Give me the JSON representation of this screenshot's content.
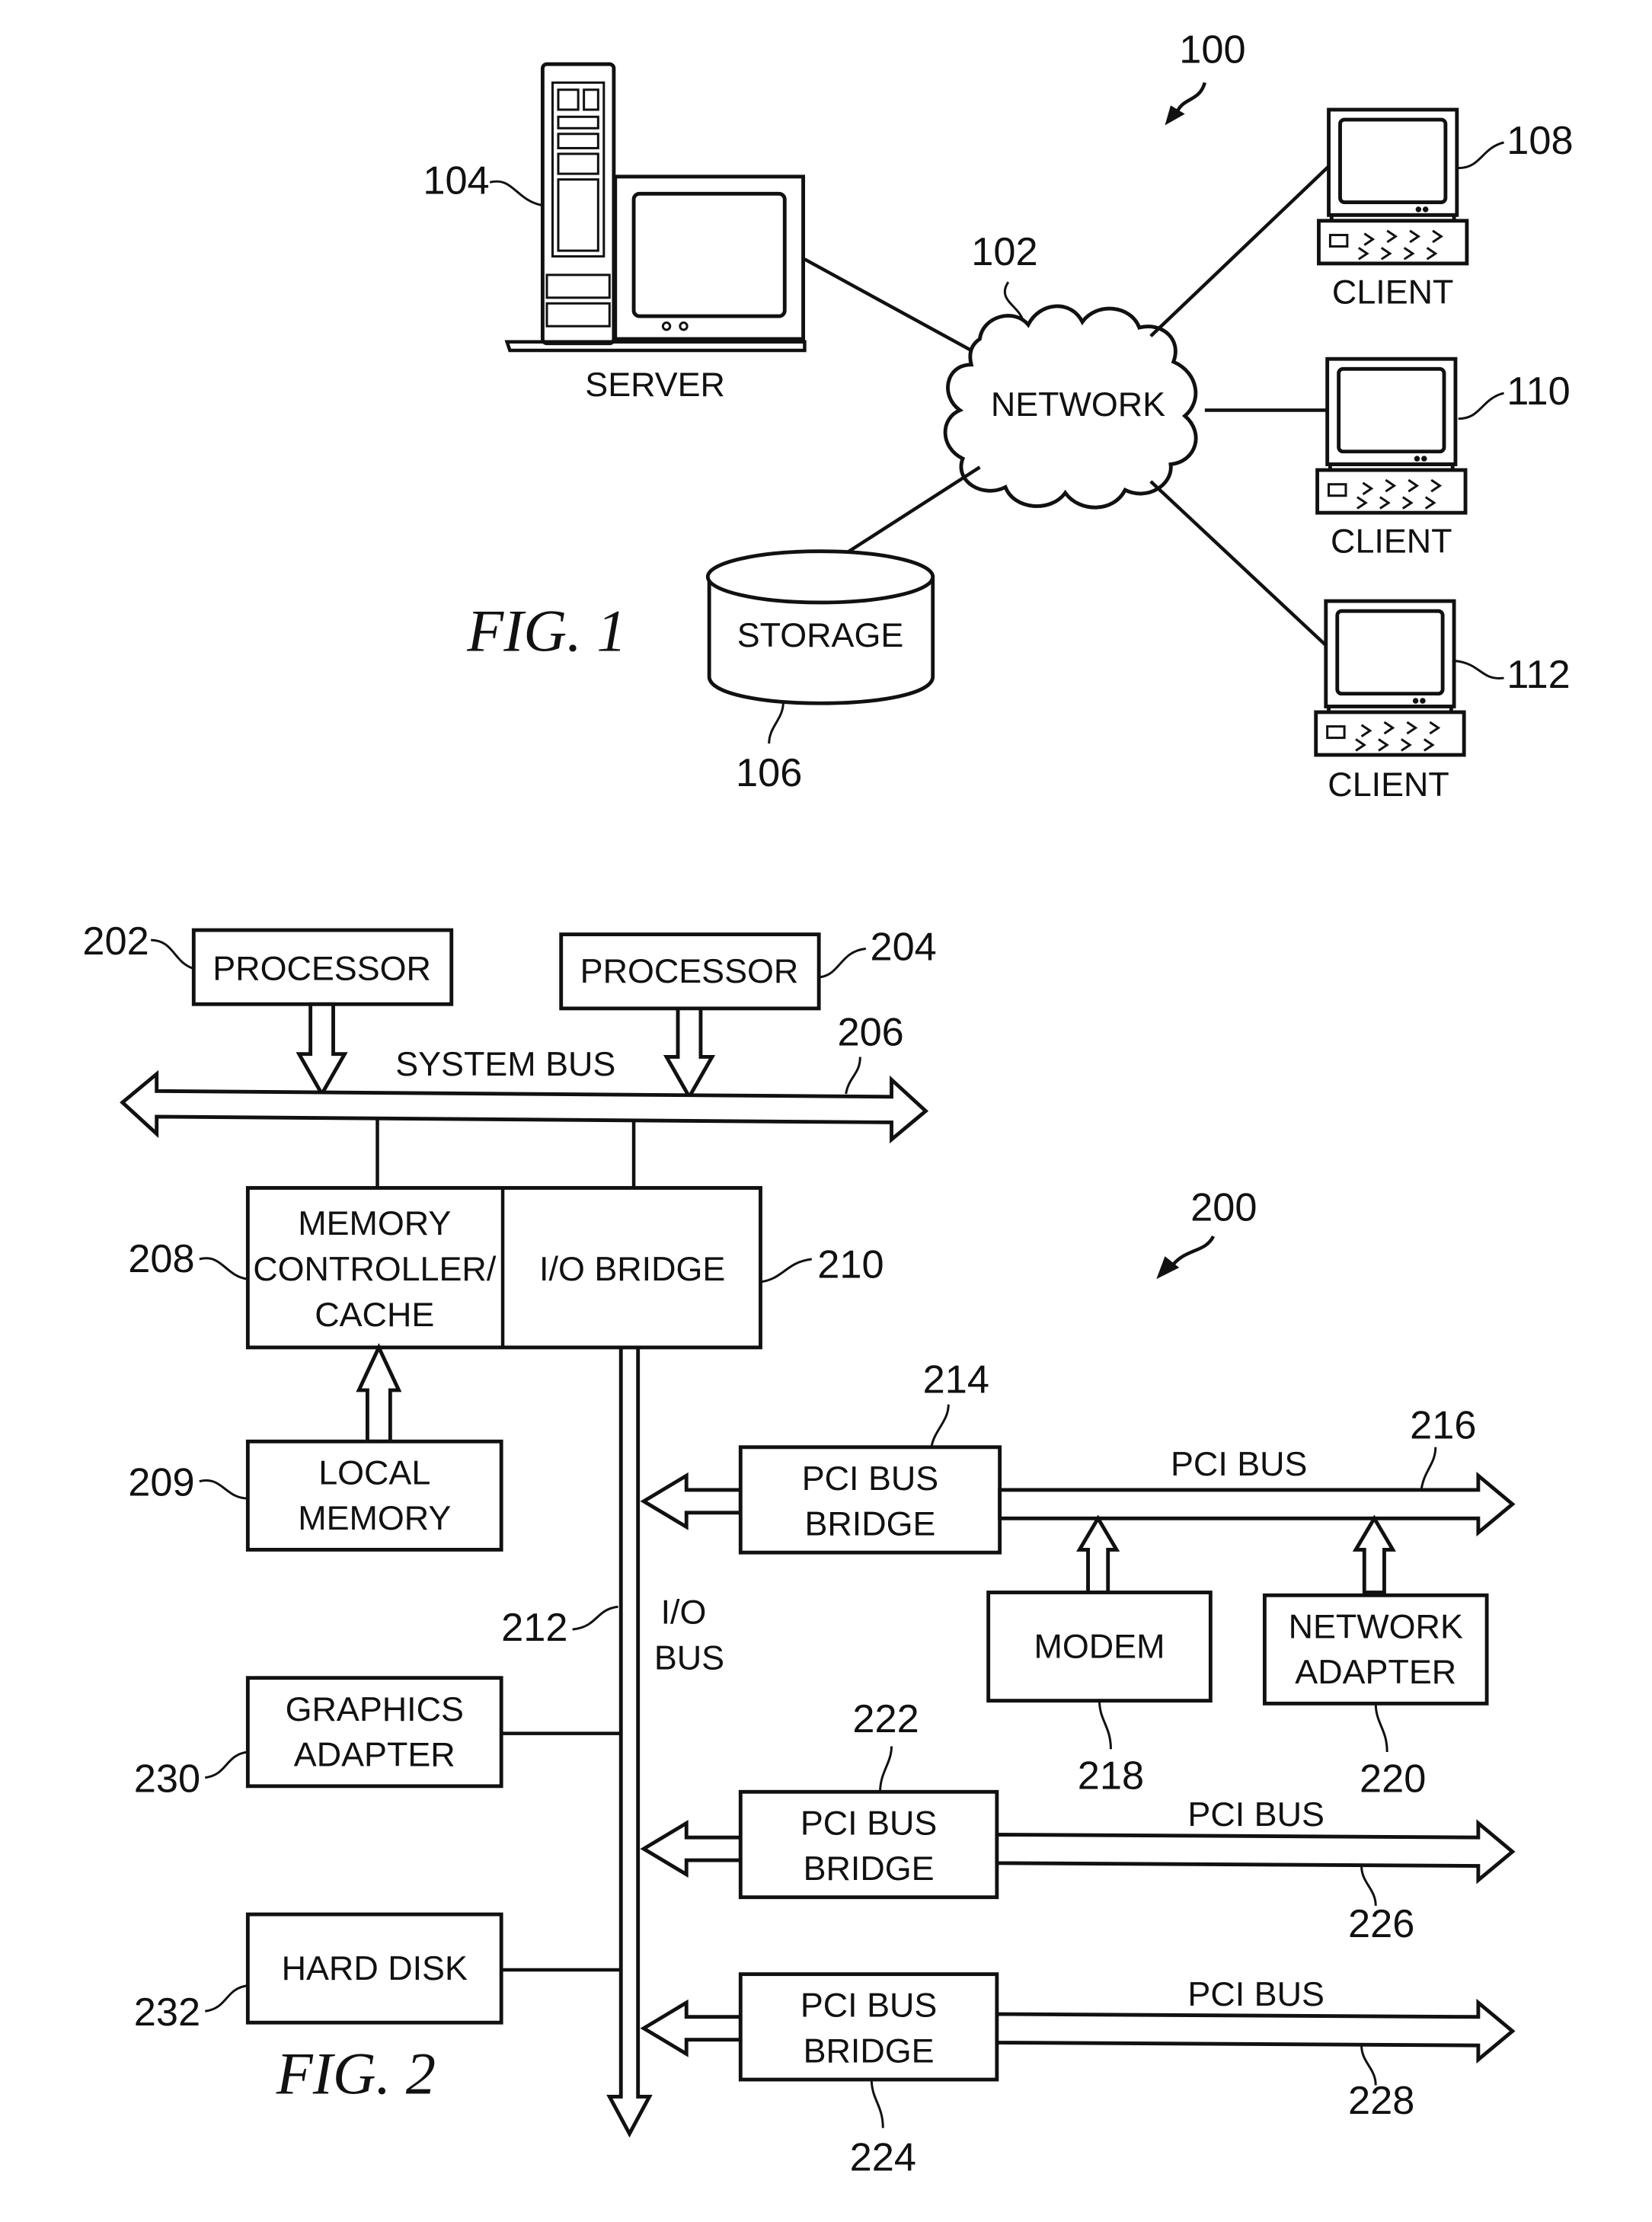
{
  "fig1": {
    "caption": "FIG. 1",
    "system_ref": "100",
    "network": {
      "label": "NETWORK",
      "ref": "102"
    },
    "server": {
      "label": "SERVER",
      "ref": "104"
    },
    "storage": {
      "label": "STORAGE",
      "ref": "106"
    },
    "clients": [
      {
        "label": "CLIENT",
        "ref": "108"
      },
      {
        "label": "CLIENT",
        "ref": "110"
      },
      {
        "label": "CLIENT",
        "ref": "112"
      }
    ]
  },
  "fig2": {
    "caption": "FIG. 2",
    "system_ref": "200",
    "processor_a": {
      "label": "PROCESSOR",
      "ref": "202"
    },
    "processor_b": {
      "label": "PROCESSOR",
      "ref": "204"
    },
    "system_bus": {
      "label": "SYSTEM BUS",
      "ref": "206"
    },
    "memory_controller": {
      "lines": [
        "MEMORY",
        "CONTROLLER/",
        "CACHE"
      ],
      "ref": "208"
    },
    "local_memory": {
      "lines": [
        "LOCAL",
        "MEMORY"
      ],
      "ref": "209"
    },
    "io_bridge": {
      "label": "I/O BRIDGE",
      "ref": "210"
    },
    "io_bus": {
      "lines": [
        "I/O",
        "BUS"
      ],
      "ref": "212"
    },
    "pci_bridge_1": {
      "lines": [
        "PCI BUS",
        "BRIDGE"
      ],
      "ref": "214"
    },
    "pci_bus_1": {
      "label": "PCI BUS",
      "ref": "216"
    },
    "modem": {
      "label": "MODEM",
      "ref": "218"
    },
    "network_adapter": {
      "lines": [
        "NETWORK",
        "ADAPTER"
      ],
      "ref": "220"
    },
    "pci_bridge_2": {
      "lines": [
        "PCI BUS",
        "BRIDGE"
      ],
      "ref": "222"
    },
    "pci_bridge_3": {
      "lines": [
        "PCI BUS",
        "BRIDGE"
      ],
      "ref": "224"
    },
    "pci_bus_2": {
      "label": "PCI BUS",
      "ref": "226"
    },
    "pci_bus_3": {
      "label": "PCI BUS",
      "ref": "228"
    },
    "graphics_adapter": {
      "lines": [
        "GRAPHICS",
        "ADAPTER"
      ],
      "ref": "230"
    },
    "hard_disk": {
      "label": "HARD DISK",
      "ref": "232"
    }
  }
}
